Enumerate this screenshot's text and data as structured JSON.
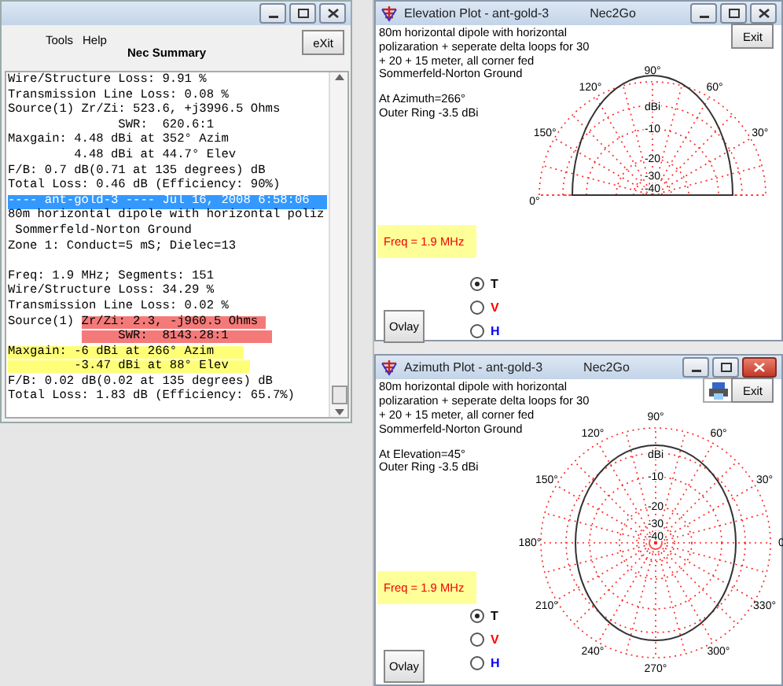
{
  "summary_window": {
    "menu": [
      "Tools",
      "Help"
    ],
    "heading": "Nec Summary",
    "exit_button": "eXit",
    "lines": [
      {
        "kind": "text",
        "selected": false,
        "parts": [
          {
            "text": "Wire/Structure Loss: 9.91 %",
            "kind": "plain"
          }
        ]
      },
      {
        "kind": "text",
        "selected": false,
        "parts": [
          {
            "text": "Transmission Line Loss: 0.08 %",
            "kind": "plain"
          }
        ]
      },
      {
        "kind": "text",
        "selected": false,
        "parts": [
          {
            "text": "Source(1) Zr/Zi: 523.6, +j3996.5 Ohms",
            "kind": "plain"
          }
        ]
      },
      {
        "kind": "text",
        "selected": false,
        "parts": [
          {
            "text": "               SWR:  620.6:1",
            "kind": "plain"
          }
        ]
      },
      {
        "kind": "text",
        "selected": false,
        "parts": [
          {
            "text": "Maxgain: 4.48 dBi at 352° Azim",
            "kind": "plain"
          }
        ]
      },
      {
        "kind": "text",
        "selected": false,
        "parts": [
          {
            "text": "         4.48 dBi at 44.7° Elev",
            "kind": "plain"
          }
        ]
      },
      {
        "kind": "text",
        "selected": false,
        "parts": [
          {
            "text": "F/B: 0.7 dB(0.71 at 135 degrees) dB",
            "kind": "plain"
          }
        ]
      },
      {
        "kind": "text",
        "selected": false,
        "parts": [
          {
            "text": "Total Loss: 0.46 dB (Efficiency: 90%)",
            "kind": "plain"
          }
        ]
      },
      {
        "kind": "text",
        "selected": true,
        "parts": [
          {
            "text": "---- ant-gold-3 ---- Jul 16, 2008 6:58:06",
            "kind": "plain"
          }
        ]
      },
      {
        "kind": "text",
        "selected": false,
        "parts": [
          {
            "text": "80m horizontal dipole with horizontal poliz",
            "kind": "plain"
          }
        ]
      },
      {
        "kind": "text",
        "selected": false,
        "parts": [
          {
            "text": " Sommerfeld-Norton Ground",
            "kind": "plain"
          }
        ]
      },
      {
        "kind": "text",
        "selected": false,
        "parts": [
          {
            "text": "Zone 1: Conduct=5 mS; Dielec=13",
            "kind": "plain"
          }
        ]
      },
      {
        "kind": "blank",
        "selected": false
      },
      {
        "kind": "text",
        "selected": false,
        "parts": [
          {
            "text": "Freq: 1.9 MHz; Segments: 151",
            "kind": "plain"
          }
        ]
      },
      {
        "kind": "text",
        "selected": false,
        "parts": [
          {
            "text": "Wire/Structure Loss: 34.29 %",
            "kind": "plain"
          }
        ]
      },
      {
        "kind": "text",
        "selected": false,
        "parts": [
          {
            "text": "Transmission Line Loss: 0.02 %",
            "kind": "plain"
          }
        ]
      },
      {
        "kind": "text",
        "selected": false,
        "parts": [
          {
            "text": "Source(1) ",
            "kind": "plain"
          },
          {
            "text": "Zr/Zi: 2.3, -j960.5 Ohms ",
            "kind": "red"
          }
        ]
      },
      {
        "kind": "text",
        "selected": false,
        "parts": [
          {
            "text": "     SWR:  8143.28:1      ",
            "kind": "redindent"
          }
        ]
      },
      {
        "kind": "text",
        "selected": false,
        "parts": [
          {
            "text": "Maxgain: -6 dBi at 266° Azim    ",
            "kind": "yellow"
          }
        ]
      },
      {
        "kind": "text",
        "selected": false,
        "parts": [
          {
            "text": "         -3.47 dBi at 88° Elev   ",
            "kind": "yellow"
          }
        ]
      },
      {
        "kind": "text",
        "selected": false,
        "parts": [
          {
            "text": "F/B: 0.02 dB(0.02 at 135 degrees) dB",
            "kind": "plain"
          }
        ]
      },
      {
        "kind": "text",
        "selected": false,
        "parts": [
          {
            "text": "Total Loss: 1.83 dB (Efficiency: 65.7%)",
            "kind": "plain"
          }
        ]
      }
    ]
  },
  "plot_windows": [
    {
      "kind": "elevation",
      "title": "Elevation Plot - ant-gold-3",
      "app_name": "Nec2Go",
      "active": false,
      "print_button": false,
      "exit_button": "Exit",
      "description": [
        "80m horizontal dipole with horizontal",
        "polizaration + seperate delta loops for 30",
        "+ 20 + 15 meter, all corner fed",
        "Sommerfeld-Norton Ground"
      ],
      "angle_info": "At Azimuth=266°",
      "outer_ring": "Outer Ring -3.5 dBi",
      "freq": "Freq = 1.9 MHz",
      "options": [
        {
          "label": "T",
          "selected": true,
          "color": "#000000"
        },
        {
          "label": "V",
          "selected": false,
          "color": "#ff0000"
        },
        {
          "label": "H",
          "selected": false,
          "color": "#0000ff"
        }
      ],
      "overlay_button": "Ovlay",
      "angle_labels": [
        "90°",
        "120°",
        "60°",
        "150°",
        "30°",
        "0°"
      ],
      "ring_labels": [
        "dBi",
        "-10",
        "-20",
        "-30",
        "-40"
      ]
    },
    {
      "kind": "azimuth",
      "title": "Azimuth Plot - ant-gold-3",
      "app_name": "Nec2Go",
      "active": true,
      "print_button": true,
      "exit_button": "Exit",
      "description": [
        "80m horizontal dipole with horizontal",
        "polizaration + seperate delta loops for 30",
        "+ 20 + 15 meter, all corner fed",
        "Sommerfeld-Norton Ground"
      ],
      "angle_info": "At Elevation=45°",
      "outer_ring": "Outer Ring -3.5 dBi",
      "freq": "Freq = 1.9 MHz",
      "options": [
        {
          "label": "T",
          "selected": true,
          "color": "#000000"
        },
        {
          "label": "V",
          "selected": false,
          "color": "#ff0000"
        },
        {
          "label": "H",
          "selected": false,
          "color": "#0000ff"
        }
      ],
      "overlay_button": "Ovlay",
      "angle_labels": [
        "90°",
        "120°",
        "60°",
        "150°",
        "30°",
        "180°",
        "0",
        "210°",
        "330°",
        "240°",
        "300°",
        "270°"
      ],
      "ring_labels": [
        "dBi",
        "-10",
        "-20",
        "-30",
        "-40"
      ]
    }
  ]
}
